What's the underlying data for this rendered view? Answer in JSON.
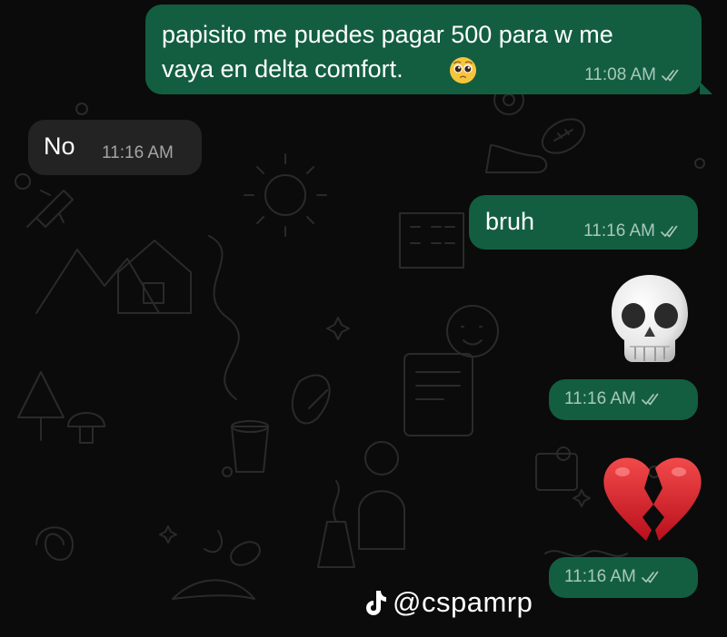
{
  "chat": {
    "messages": [
      {
        "direction": "outgoing",
        "text_line1": "papisito me puedes pagar 500 para w me",
        "text_line2": "vaya en delta comfort.",
        "emoji": "pleading-face",
        "time": "11:08 AM",
        "status": "read"
      },
      {
        "direction": "incoming",
        "text": "No",
        "time": "11:16 AM"
      },
      {
        "direction": "outgoing",
        "text": "bruh",
        "time": "11:16 AM",
        "status": "read"
      },
      {
        "direction": "outgoing",
        "emoji": "skull",
        "time": "11:16 AM",
        "status": "read"
      },
      {
        "direction": "outgoing",
        "emoji": "broken-heart",
        "time": "11:16 AM",
        "status": "read"
      }
    ]
  },
  "watermark": {
    "icon": "tiktok-logo",
    "handle": "@cspamrp"
  },
  "colors": {
    "background": "#0b0b0b",
    "outgoing_bubble": "#135e41",
    "incoming_bubble": "#232323",
    "read_ticks": "#a8c8ba"
  }
}
